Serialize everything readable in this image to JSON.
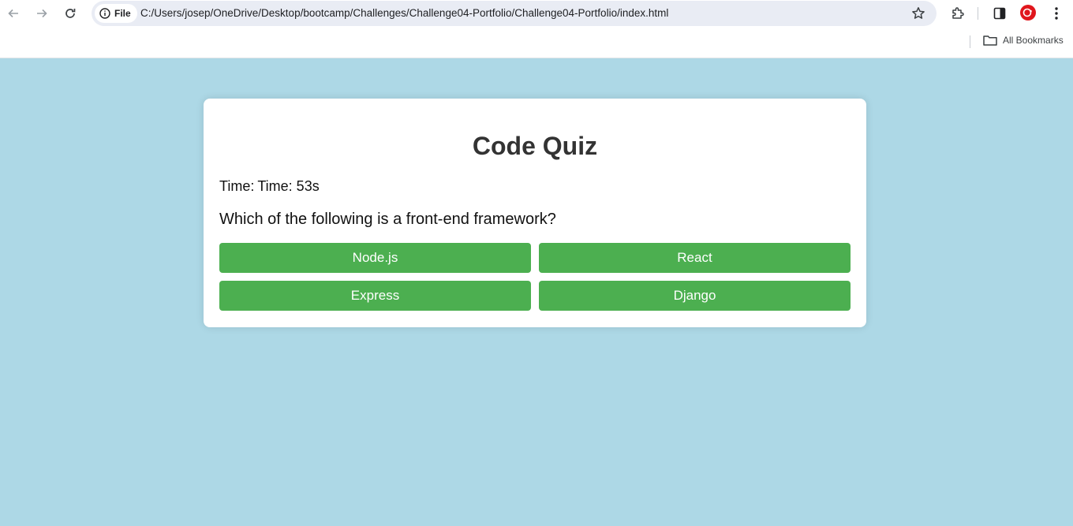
{
  "browser": {
    "site_info_label": "File",
    "url": "C:/Users/josep/OneDrive/Desktop/bootcamp/Challenges/Challenge04-Portfolio/Challenge04-Portfolio/index.html",
    "bookmarks_label": "All Bookmarks"
  },
  "quiz": {
    "title": "Code Quiz",
    "timer_label": "Time:",
    "timer_value": "Time: 53s",
    "question": "Which of the following is a front-end framework?",
    "choices": [
      "Node.js",
      "React",
      "Express",
      "Django"
    ],
    "button_color": "#4caf50",
    "background_color": "#add8e6"
  }
}
